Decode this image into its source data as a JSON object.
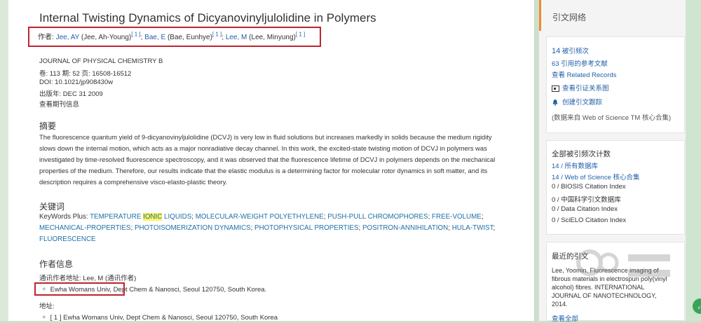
{
  "article": {
    "title": "Internal Twisting Dynamics of Dicyanovinyljulolidine in Polymers",
    "authors_label": "作者:",
    "authors": [
      {
        "name": "Jee, AY",
        "full": "(Jee, Ah-Young)",
        "ref": "[ 1 ]"
      },
      {
        "name": "Bae, E",
        "full": "(Bae, Eunhye)",
        "ref": "[ 1 ]"
      },
      {
        "name": "Lee, M",
        "full": "(Lee, Minyung)",
        "ref": "[ 1 ]"
      }
    ],
    "journal": "JOURNAL OF PHYSICAL CHEMISTRY B",
    "volume_line": "卷:  113   期:  52   页:  16508-16512",
    "doi_line": "DOI:   10.1021/jp908430w",
    "pubyear_line": "出版年:   DEC 31 2009",
    "journal_info_link": "查看期刊信息"
  },
  "abstract": {
    "heading": "摘要",
    "text": "The fluorescence quantum yield of 9-dicyanovinyljulolidine (DCVJ) is very low in fluid solutions but increases markedly in solids because the medium rigidity slows down the internal motion, which acts as a major nonradiative decay channel. In this work, the excited-state twisting motion of DCVJ in polymers was investigated by time-resolved fluorescence spectroscopy, and it was observed that the fluorescence lifetime of DCVJ in polymers depends on the mechanical properties of the medium. Therefore, our results indicate that the elastic modulus is a determining factor for molecular rotor dynamics in soft matter, and its description requires a comprehensive visco-elasto-plastic theory."
  },
  "keywords": {
    "heading": "关键词",
    "prefix": "KeyWords Plus: ",
    "kw1a": "TEMPERATURE ",
    "kw1hl": "IONIC",
    "kw1b": " LIQUIDS",
    "rest": [
      "MOLECULAR-WEIGHT POLYETHYLENE",
      "PUSH-PULL CHROMOPHORES",
      "FREE-VOLUME",
      "MECHANICAL-PROPERTIES",
      "PHOTOISOMERIZATION DYNAMICS",
      "PHOTOPHYSICAL PROPERTIES",
      "POSITRON-ANNIHILATION",
      "HULA-TWIST",
      "FLUORESCENCE"
    ]
  },
  "author_info": {
    "heading": "作者信息",
    "corresponding": "通讯作者地址:  Lee, M (通讯作者)",
    "org": "Ewha Womans Univ",
    "org_rest": ", Dept Chem & Nanosci, Seoul 120750, South Korea.",
    "address_label": "地址:",
    "address_line": "[ 1 ] Ewha Womans Univ, Dept Chem & Nanosci, Seoul 120750, South Korea"
  },
  "sidebar": {
    "tab_title": "引文网络",
    "times_cited_num": "14",
    "times_cited_label": "被引频次",
    "refs": "63 引用的参考文献",
    "related": "查看 Related Records",
    "citation_map": "查看引证关系图",
    "alert": "创建引文跟踪",
    "source_note": "(数据来自 Web of Science TM 核心合集)",
    "all_counts_title": "全部被引频次计数",
    "counts": [
      {
        "label": "14 / 所有数据库",
        "link": true
      },
      {
        "label": "14 / Web of Science 核心合集",
        "link": true
      },
      {
        "label": "0 / BIOSIS Citation Index",
        "link": false
      },
      {
        "label": "0 / 中国科学引文数据库",
        "link": false
      },
      {
        "label": "0 / Data Citation Index",
        "link": false
      },
      {
        "label": "0 / SciELO Citation Index",
        "link": false
      }
    ],
    "recent_title": "最近的引文",
    "recent_text": "Lee, Yoomin. Fluorescence imaging of fibrous materials in electrospun poly(vinyl alcohol) fibres. INTERNATIONAL JOURNAL OF NANOTECHNOLOGY, 2014.",
    "view_all": "查看全部"
  },
  "colors": {
    "link": "#1f5fa8",
    "highlight_box": "#c0232e",
    "accent_tab": "#f08a2b",
    "keyword_highlight": "#fff35a"
  }
}
